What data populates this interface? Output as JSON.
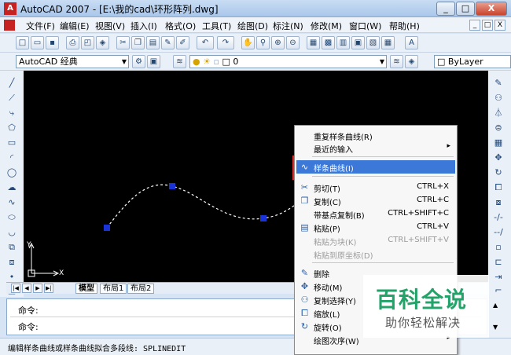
{
  "window": {
    "app_icon": "A",
    "title": "AutoCAD 2007 - [E:\\我的cad\\环形阵列.dwg]",
    "controls": [
      "_",
      "□",
      "X"
    ]
  },
  "menubar": {
    "items": [
      "文件(F)",
      "编辑(E)",
      "视图(V)",
      "插入(I)",
      "格式(O)",
      "工具(T)",
      "绘图(D)",
      "标注(N)",
      "修改(M)",
      "窗口(W)",
      "帮助(H)"
    ],
    "mdi_controls": [
      "_",
      "□",
      "X"
    ]
  },
  "toolbar1": {
    "icons": [
      "new-icon",
      "open-icon",
      "save-icon",
      "print-icon",
      "preview-icon",
      "publish-icon",
      "cut-icon",
      "copy-icon",
      "paste-icon",
      "brush-icon",
      "matchprop-icon",
      "undo-icon",
      "redo-icon",
      "pan-icon",
      "zoom-realtime-icon",
      "zoom-window-icon",
      "zoom-previous-icon",
      "properties-icon",
      "designcenter-icon",
      "toolpalettes-icon",
      "sheetset-icon",
      "markup-icon",
      "calculator-icon",
      "text-style-icon"
    ]
  },
  "toolbar2": {
    "workspace_value": "AutoCAD 经典",
    "layer_value": "0",
    "color_value": "ByLayer"
  },
  "layout_tabs": [
    "模型",
    "布局1",
    "布局2"
  ],
  "command": {
    "line1": "命令:",
    "line2": "命令:"
  },
  "status": {
    "text": "编辑样条曲线或样条曲线拟合多段线:  SPLINEDIT"
  },
  "ucs": {
    "x_label": "X",
    "y_label": "Y"
  },
  "context_menu": {
    "items": [
      {
        "label": "重复样条曲线(R)",
        "shortcut": "",
        "submenu": false,
        "disabled": false,
        "icon": ""
      },
      {
        "label": "最近的输入",
        "shortcut": "",
        "submenu": true,
        "disabled": false,
        "icon": ""
      },
      {
        "label": "样条曲线(I)",
        "shortcut": "",
        "submenu": false,
        "disabled": false,
        "icon": "spline-icon",
        "highlight": true
      },
      {
        "label": "剪切(T)",
        "shortcut": "CTRL+X",
        "submenu": false,
        "disabled": false,
        "icon": "cut-icon"
      },
      {
        "label": "复制(C)",
        "shortcut": "CTRL+C",
        "submenu": false,
        "disabled": false,
        "icon": "copy-icon"
      },
      {
        "label": "带基点复制(B)",
        "shortcut": "CTRL+SHIFT+C",
        "submenu": false,
        "disabled": false,
        "icon": ""
      },
      {
        "label": "粘贴(P)",
        "shortcut": "CTRL+V",
        "submenu": false,
        "disabled": false,
        "icon": "paste-icon"
      },
      {
        "label": "粘贴为块(K)",
        "shortcut": "CTRL+SHIFT+V",
        "submenu": false,
        "disabled": true,
        "icon": ""
      },
      {
        "label": "粘贴到原坐标(D)",
        "shortcut": "",
        "submenu": false,
        "disabled": true,
        "icon": ""
      },
      {
        "label": "删除",
        "shortcut": "",
        "submenu": false,
        "disabled": false,
        "icon": "erase-icon"
      },
      {
        "label": "移动(M)",
        "shortcut": "",
        "submenu": false,
        "disabled": false,
        "icon": "move-icon"
      },
      {
        "label": "复制选择(Y)",
        "shortcut": "",
        "submenu": false,
        "disabled": false,
        "icon": "copy-select-icon"
      },
      {
        "label": "缩放(L)",
        "shortcut": "",
        "submenu": false,
        "disabled": false,
        "icon": "scale-icon"
      },
      {
        "label": "旋转(O)",
        "shortcut": "",
        "submenu": false,
        "disabled": false,
        "icon": "rotate-icon"
      },
      {
        "label": "绘图次序(W)",
        "shortcut": "",
        "submenu": true,
        "disabled": false,
        "icon": ""
      }
    ]
  },
  "watermark": {
    "title": "百科全说",
    "subtitle": "助你轻松解决"
  },
  "colors": {
    "highlight": "#3c78d8",
    "callout_red": "#e03030",
    "grip_blue": "#1a33d6",
    "canvas": "#000000"
  }
}
